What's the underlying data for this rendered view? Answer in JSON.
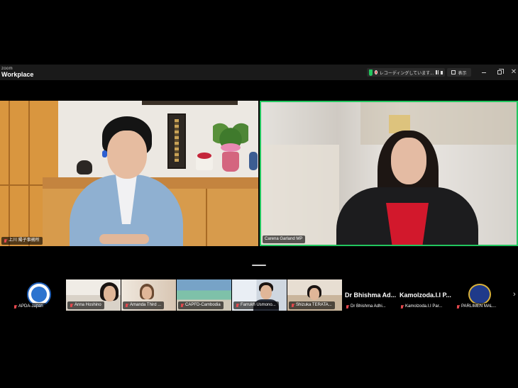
{
  "app": {
    "brand_top": "zoom",
    "brand_main": "Workplace",
    "recording_text": "レコーディングしています...",
    "view_label": "表示",
    "close_glyph": "✕"
  },
  "colors": {
    "active_speaker_border": "#22c55e",
    "muted_mic": "#e5484d",
    "recording_dot": "#e5484d",
    "shield": "#23c55e"
  },
  "main_tiles": [
    {
      "name": "上川 陽子事務所",
      "muted": true
    },
    {
      "name": "Carena Garland MP",
      "muted": false,
      "active_speaker": true
    }
  ],
  "strip": {
    "participants": [
      {
        "name": "APDA-Japan",
        "muted": true,
        "avatar": "apda-logo"
      },
      {
        "name": "Anna Hoshino",
        "muted": true
      },
      {
        "name": "Amanda Third ...",
        "muted": true
      },
      {
        "name": "CAPFD-Cambodia",
        "muted": true
      },
      {
        "name": "Farrukh Usmono...",
        "muted": true
      },
      {
        "name": "Shizuka TERATA...",
        "muted": true
      },
      {
        "name": "Dr Bhishma Adhi...",
        "display": "Dr Bhishma Ad...",
        "muted": true
      },
      {
        "name": "Kamolzoda.I.I Par...",
        "display": "Kamolzoda.I.I P...",
        "muted": true
      },
      {
        "name": "PARLIMEN MAL...",
        "muted": true,
        "avatar": "parlimen-logo"
      }
    ],
    "next_glyph": "›"
  }
}
